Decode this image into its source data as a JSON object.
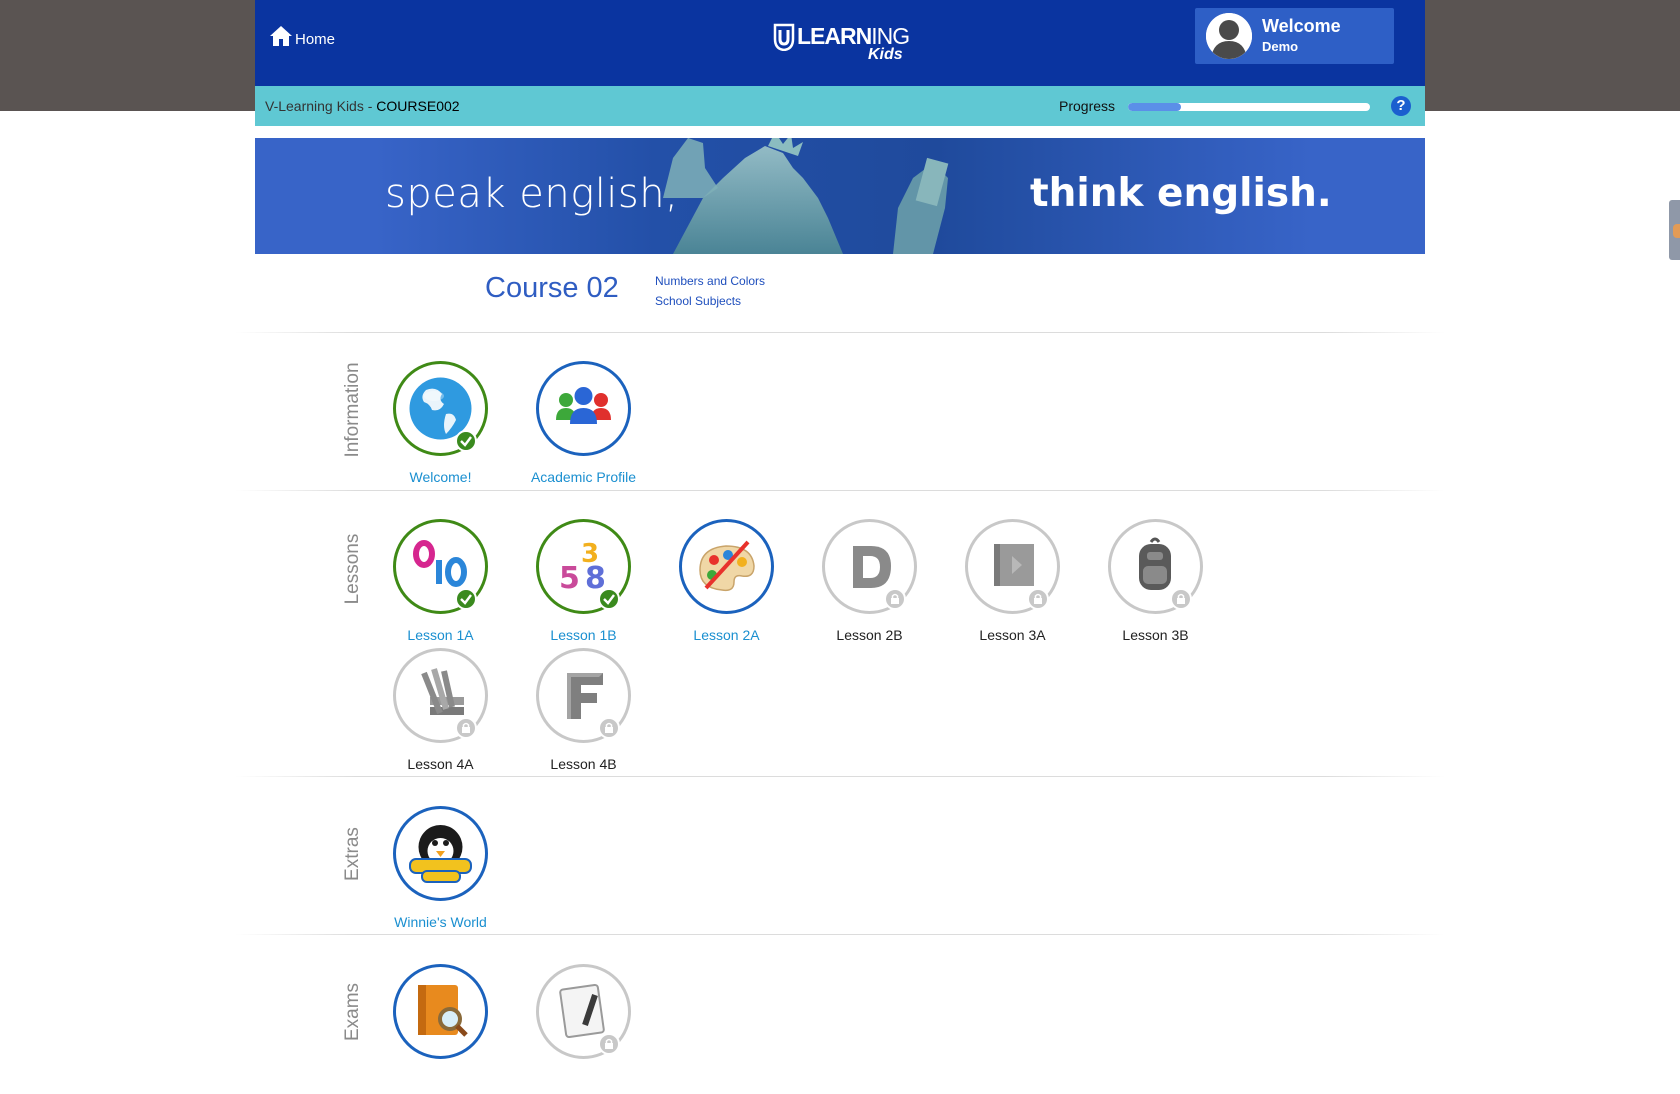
{
  "header": {
    "home_label": "Home",
    "logo_text_bold": "LEARN",
    "logo_text_thin": "ING",
    "logo_sub": "Kids",
    "welcome_title": "Welcome",
    "welcome_name": "Demo"
  },
  "course_bar": {
    "school": "V-Learning Kids - ",
    "course_code": "COURSE002",
    "progress_label": "Progress",
    "progress_fraction": 0.22,
    "help_symbol": "?"
  },
  "banner": {
    "left_text": "speak english,",
    "right_text": "think english."
  },
  "course": {
    "title": "Course 02",
    "topics": [
      "Numbers and Colors",
      "School Subjects"
    ]
  },
  "sections": {
    "information": {
      "label": "Information",
      "items": [
        {
          "label": "Welcome!",
          "icon": "globe-icon",
          "state": "completed"
        },
        {
          "label": "Academic Profile",
          "icon": "people-icon",
          "state": "available"
        }
      ]
    },
    "lessons": {
      "label": "Lessons",
      "items": [
        {
          "label": "Lesson 1A",
          "icon": "zero-ten-numbers-icon",
          "state": "completed"
        },
        {
          "label": "Lesson 1B",
          "icon": "colorful-numbers-icon",
          "state": "completed"
        },
        {
          "label": "Lesson 2A",
          "icon": "paint-palette-icon",
          "state": "available"
        },
        {
          "label": "Lesson 2B",
          "icon": "letter-d-icon",
          "state": "locked"
        },
        {
          "label": "Lesson 3A",
          "icon": "book-icon",
          "state": "locked"
        },
        {
          "label": "Lesson 3B",
          "icon": "backpack-icon",
          "state": "locked"
        },
        {
          "label": "Lesson 4A",
          "icon": "pencils-books-icon",
          "state": "locked"
        },
        {
          "label": "Lesson 4B",
          "icon": "letter-f-icon",
          "state": "locked"
        }
      ]
    },
    "extras": {
      "label": "Extras",
      "items": [
        {
          "label": "Winnie's World",
          "icon": "winnies-world-penguin-icon",
          "state": "available"
        }
      ]
    },
    "exams": {
      "label": "Exams",
      "items": [
        {
          "label": "",
          "icon": "book-magnifier-icon",
          "state": "available"
        },
        {
          "label": "",
          "icon": "paper-pencil-icon",
          "state": "locked"
        }
      ]
    }
  },
  "colors": {
    "header_blue": "#0a34a0",
    "course_bar_teal": "#5fc8d3",
    "link_blue": "#1a8fd0",
    "complete_green": "#3f8a16",
    "available_blue": "#1b62bd",
    "locked_gray": "#c8c8c8"
  }
}
